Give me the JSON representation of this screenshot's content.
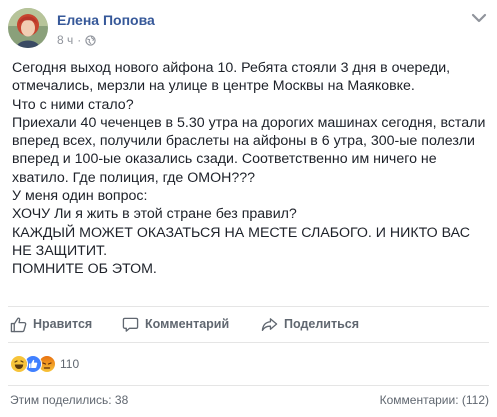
{
  "post": {
    "author": "Елена Попова",
    "time": "8 ч",
    "dot": "·",
    "lines": [
      "Сегодня выход нового айфона 10. Ребята стояли 3 дня в очереди,",
      "отмечались, мерзли на улице в центре Москвы на Маяковке.",
      "Что с ними стало?",
      "Приехали 40 чеченцев в 5.30 утра на дорогих машинах сегодня, встали",
      "вперед всех, получили браслеты на айфоны в 6 утра, 300-ые полезли",
      "вперед и 100-ые оказались сзади. Соответственно им ничего не",
      "хватило. Где полиция, где ОМОН???",
      "У меня один вопрос:",
      "ХОЧУ Ли я жить в этой стране без правил?",
      "КАЖДЫЙ МОЖЕТ ОКАЗАТЬСЯ НА МЕСТЕ СЛАБОГО. И НИКТО ВАС",
      "НЕ ЗАЩИТИТ.",
      "ПОМНИТЕ ОБ ЭТОМ."
    ]
  },
  "actions": {
    "like": "Нравится",
    "comment": "Комментарий",
    "share": "Поделиться"
  },
  "reactions": {
    "icons": [
      "haha-icon",
      "like-icon",
      "angry-icon"
    ],
    "count": "110"
  },
  "footer": {
    "shares": "Этим поделились: 38",
    "comments": "Комментарии: (112)"
  },
  "colors": {
    "author_link": "#365899",
    "secondary_text": "#90949c",
    "action_text": "#606770",
    "like_blue": "#4080ff",
    "haha_yellow": "#f7c43a",
    "angry_orange": "#e9710f"
  }
}
